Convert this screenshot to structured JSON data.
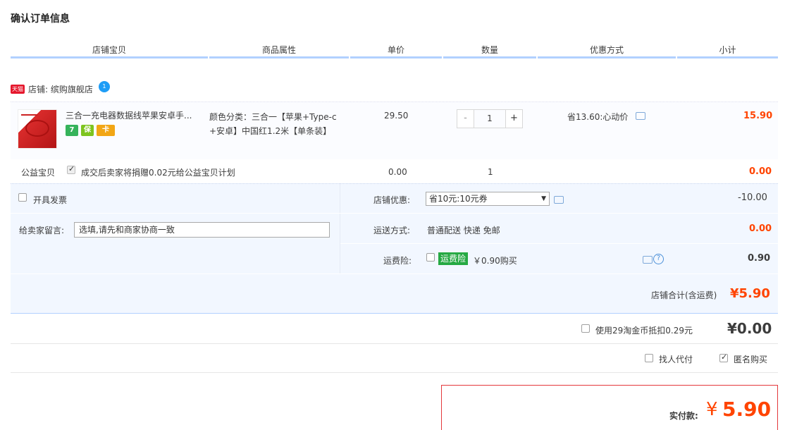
{
  "page": {
    "title": "确认订单信息"
  },
  "columns": [
    "店铺宝贝",
    "商品属性",
    "单价",
    "数量",
    "优惠方式",
    "小计"
  ],
  "shop": {
    "badge": "天猫",
    "label": "店铺: 缤购旗舰店",
    "chat_badge": "1"
  },
  "item": {
    "title": "三合一充电器数据线苹果安卓手...",
    "service_badges": [
      {
        "icon": "7-day-return-icon",
        "text": "7",
        "color": "#36b35b"
      },
      {
        "icon": "guarantee-icon",
        "text": "保",
        "color": "#7dc41f"
      },
      {
        "icon": "card-icon",
        "text": "卡",
        "color": "#f2a615"
      }
    ],
    "attr_line1": "颜色分类：三合一【苹果+Type-c",
    "attr_line2": "+安卓】中国红1.2米【单条装】",
    "unit_price": "29.50",
    "quantity": "1",
    "minus": "-",
    "plus": "+",
    "discount": "省13.60:心动价",
    "subtotal": "15.90"
  },
  "charity": {
    "label": "公益宝贝",
    "text": "成交后卖家将捐赠0.02元给公益宝贝计划",
    "price": "0.00",
    "qty": "1",
    "subtotal": "0.00"
  },
  "invoice": {
    "label": "开具发票"
  },
  "shop_discount": {
    "label": "店铺优惠:",
    "selected": "省10元:10元券",
    "amount": "-10.00"
  },
  "message": {
    "label": "给卖家留言:",
    "placeholder": "选填,请先和商家协商一致"
  },
  "shipping": {
    "label": "运送方式:",
    "value": "普通配送 快递 免邮",
    "amount": "0.00"
  },
  "insurance": {
    "label": "运费险:",
    "tag": "运费险",
    "value": "￥0.90购买",
    "amount": "0.90"
  },
  "shop_total": {
    "label": "店铺合计(含运费)",
    "amount": "¥5.90"
  },
  "taojinbi": {
    "label": "使用29淘金币抵扣0.29元",
    "amount": "¥0.00"
  },
  "options": {
    "proxy_pay": "找人代付",
    "anonymous": "匿名购买"
  },
  "pay": {
    "label": "实付款:",
    "currency": "¥",
    "amount": "5.90"
  },
  "colors": {
    "accent_red": "#ff4400",
    "header_line": "#b2d1ff",
    "panel_bg": "#f2f7ff"
  }
}
